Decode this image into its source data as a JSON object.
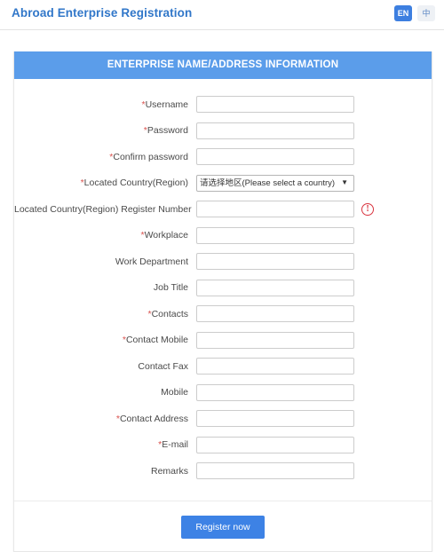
{
  "topbar": {
    "title": "Abroad Enterprise Registration",
    "lang_en": "EN",
    "lang_zh": "中"
  },
  "card": {
    "header": "ENTERPRISE NAME/ADDRESS INFORMATION",
    "fields": [
      {
        "label": "Username",
        "required": true,
        "type": "text",
        "value": ""
      },
      {
        "label": "Password",
        "required": true,
        "type": "text",
        "value": ""
      },
      {
        "label": "Confirm password",
        "required": true,
        "type": "text",
        "value": ""
      },
      {
        "label": "Located Country(Region)",
        "required": true,
        "type": "select",
        "value": "请选择地区(Please select a country)"
      },
      {
        "label": "Located Country(Region) Register Number",
        "required": false,
        "type": "text",
        "value": "",
        "error": true
      },
      {
        "label": "Workplace",
        "required": true,
        "type": "text",
        "value": ""
      },
      {
        "label": "Work Department",
        "required": false,
        "type": "text",
        "value": ""
      },
      {
        "label": "Job Title",
        "required": false,
        "type": "text",
        "value": ""
      },
      {
        "label": "Contacts",
        "required": true,
        "type": "text",
        "value": ""
      },
      {
        "label": "Contact Mobile",
        "required": true,
        "type": "text",
        "value": ""
      },
      {
        "label": "Contact Fax",
        "required": false,
        "type": "text",
        "value": ""
      },
      {
        "label": "Mobile",
        "required": false,
        "type": "text",
        "value": ""
      },
      {
        "label": "Contact Address",
        "required": true,
        "type": "text",
        "value": ""
      },
      {
        "label": "E-mail",
        "required": true,
        "type": "text",
        "value": ""
      },
      {
        "label": "Remarks",
        "required": false,
        "type": "text",
        "value": ""
      }
    ],
    "select_caret_icon": "chevron-down-icon",
    "error_icon_glyph": "!",
    "submit_label": "Register now"
  },
  "colors": {
    "header_blue": "#5b9dea",
    "title_blue": "#3177c9",
    "button_blue": "#3d82e5",
    "required_red": "#d9534f",
    "error_red": "#d9343f"
  }
}
